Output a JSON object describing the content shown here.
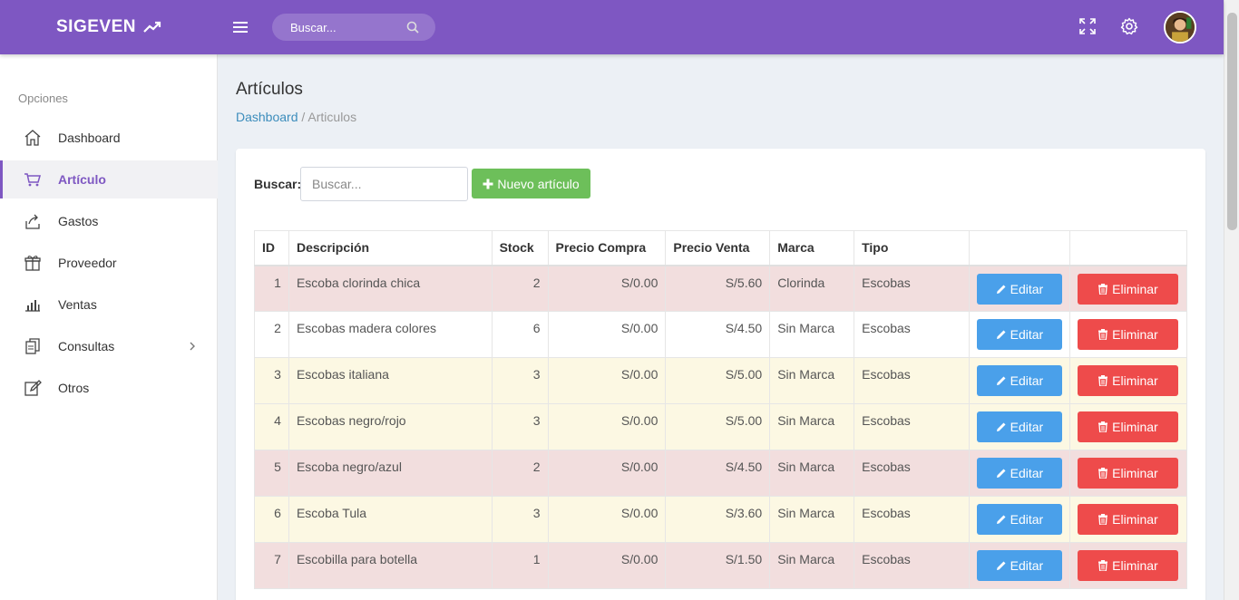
{
  "app": {
    "brand": "SIGEVEN",
    "top_search_placeholder": "Buscar..."
  },
  "sidebar": {
    "header": "Opciones",
    "items": [
      {
        "label": "Dashboard",
        "icon": "home-icon"
      },
      {
        "label": "Artículo",
        "icon": "cart-icon"
      },
      {
        "label": "Gastos",
        "icon": "share-icon"
      },
      {
        "label": "Proveedor",
        "icon": "gift-icon"
      },
      {
        "label": "Ventas",
        "icon": "bar-chart-icon"
      },
      {
        "label": "Consultas",
        "icon": "copy-icon"
      },
      {
        "label": "Otros",
        "icon": "edit-icon"
      }
    ]
  },
  "page": {
    "title": "Artículos",
    "breadcrumb_link": "Dashboard",
    "breadcrumb_sep": " / ",
    "breadcrumb_current": "Articulos"
  },
  "toolbar": {
    "search_label": "Buscar:",
    "search_placeholder": "Buscar...",
    "new_button": "Nuevo artículo"
  },
  "table": {
    "columns": [
      "ID",
      "Descripción",
      "Stock",
      "Precio Compra",
      "Precio Venta",
      "Marca",
      "Tipo",
      "",
      ""
    ],
    "edit_label": "Editar",
    "delete_label": "Eliminar",
    "rows": [
      {
        "id": "1",
        "desc": "Escoba clorinda chica",
        "stock": "2",
        "compra": "S/0.00",
        "venta": "S/5.60",
        "marca": "Clorinda",
        "tipo": "Escobas",
        "status": "red"
      },
      {
        "id": "2",
        "desc": "Escobas madera colores",
        "stock": "6",
        "compra": "S/0.00",
        "venta": "S/4.50",
        "marca": "Sin Marca",
        "tipo": "Escobas",
        "status": "white"
      },
      {
        "id": "3",
        "desc": "Escobas italiana",
        "stock": "3",
        "compra": "S/0.00",
        "venta": "S/5.00",
        "marca": "Sin Marca",
        "tipo": "Escobas",
        "status": "yellow"
      },
      {
        "id": "4",
        "desc": "Escobas negro/rojo",
        "stock": "3",
        "compra": "S/0.00",
        "venta": "S/5.00",
        "marca": "Sin Marca",
        "tipo": "Escobas",
        "status": "yellow"
      },
      {
        "id": "5",
        "desc": "Escoba negro/azul",
        "stock": "2",
        "compra": "S/0.00",
        "venta": "S/4.50",
        "marca": "Sin Marca",
        "tipo": "Escobas",
        "status": "red"
      },
      {
        "id": "6",
        "desc": "Escoba Tula",
        "stock": "3",
        "compra": "S/0.00",
        "venta": "S/3.60",
        "marca": "Sin Marca",
        "tipo": "Escobas",
        "status": "yellow"
      },
      {
        "id": "7",
        "desc": "Escobilla para botella",
        "stock": "1",
        "compra": "S/0.00",
        "venta": "S/1.50",
        "marca": "Sin Marca",
        "tipo": "Escobas",
        "status": "red"
      }
    ]
  },
  "colors": {
    "header": "#7e57c2",
    "row_red": "#f2dede",
    "row_yellow": "#fcf8e3",
    "edit": "#4aa0ea",
    "delete": "#ee4b4b",
    "new": "#6dbf5a"
  }
}
